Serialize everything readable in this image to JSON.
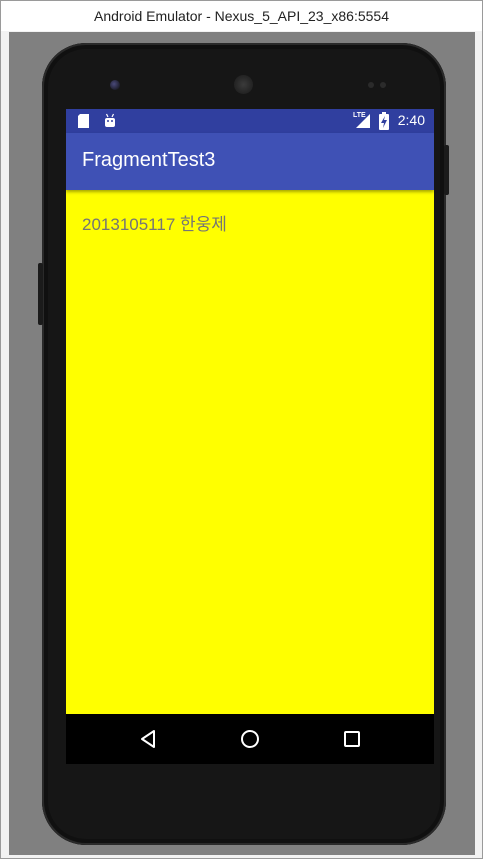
{
  "window": {
    "title": "Android Emulator - Nexus_5_API_23_x86:5554"
  },
  "status_bar": {
    "left_icons": [
      "sd-card-icon",
      "android-debug-icon"
    ],
    "right_icons": [
      "lte-icon",
      "signal-icon",
      "battery-charging-icon"
    ],
    "network_label": "LTE",
    "time": "2:40"
  },
  "app_bar": {
    "title": "FragmentTest3"
  },
  "content": {
    "text": "2013105117 한웅제"
  },
  "nav_bar": {
    "buttons": [
      "back-icon",
      "home-icon",
      "recents-icon"
    ]
  },
  "colors": {
    "status_bar": "#303f9f",
    "app_bar": "#3f51b5",
    "content_background": "#ffff00",
    "content_text": "#757575",
    "nav_bar": "#000000",
    "emulator_background": "#808080",
    "phone_body": "#161616"
  }
}
